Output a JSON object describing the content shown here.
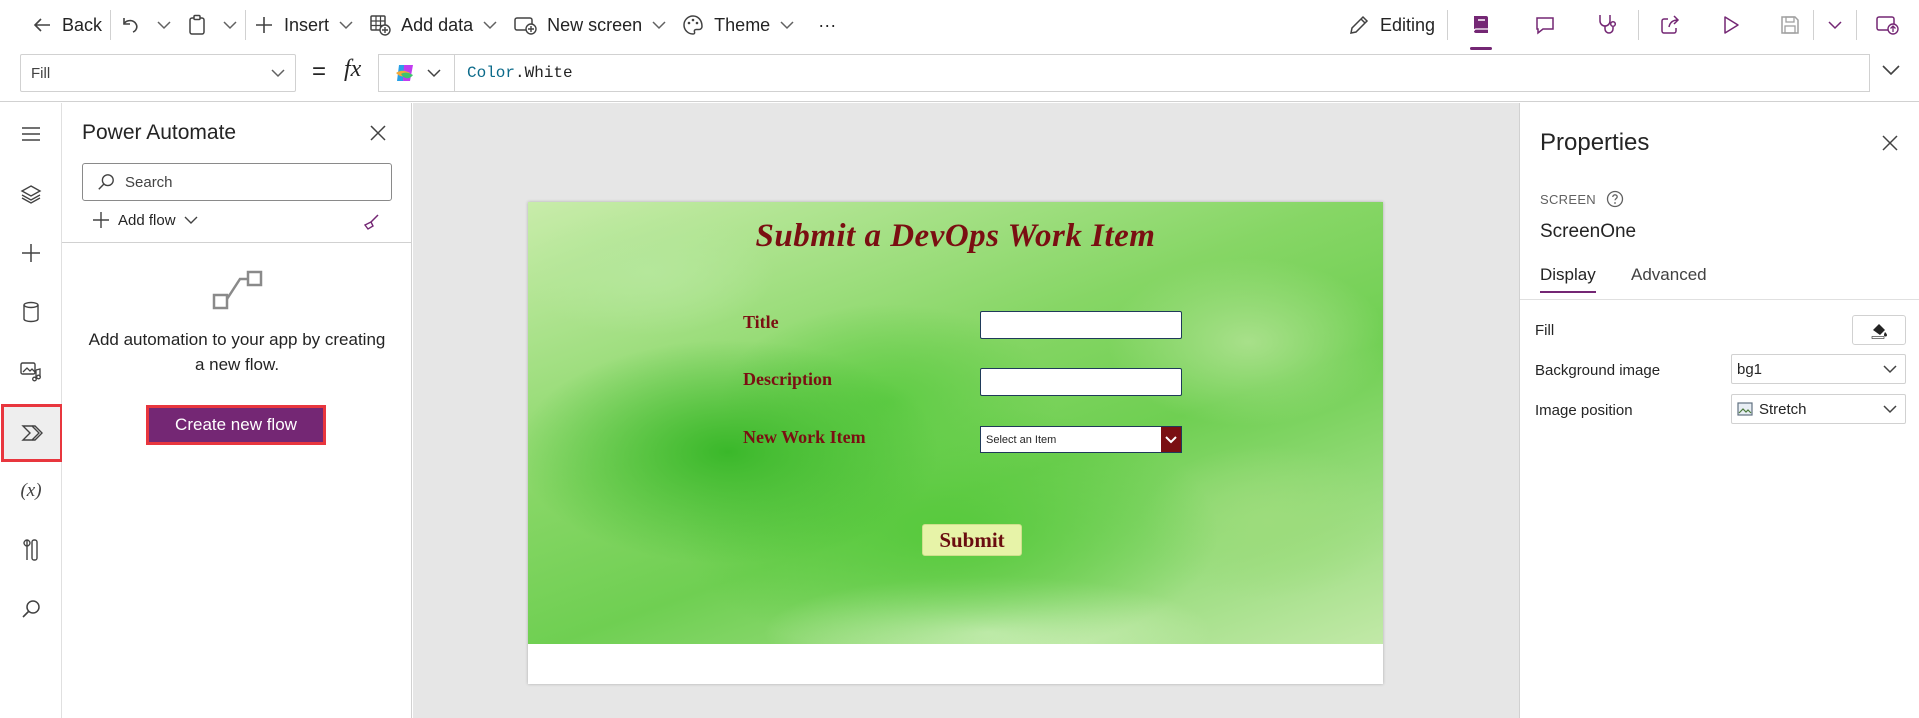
{
  "toolbar": {
    "back_label": "Back",
    "insert_label": "Insert",
    "add_data_label": "Add data",
    "new_screen_label": "New screen",
    "theme_label": "Theme",
    "more_label": "···",
    "editing_label": "Editing"
  },
  "formula": {
    "property": "Fill",
    "equals": "=",
    "fx": "fx",
    "value_keyword": "Color",
    "value_rest": ".White"
  },
  "power_automate": {
    "title": "Power Automate",
    "search_placeholder": "Search",
    "add_flow_label": "Add flow",
    "empty_message": "Add automation to your app by creating a new flow.",
    "create_button": "Create new flow"
  },
  "rail": {
    "variables_label": "(x)"
  },
  "app_screen": {
    "title": "Submit a DevOps Work Item",
    "fields": [
      {
        "label": "Title"
      },
      {
        "label": "Description"
      },
      {
        "label": "New Work Item"
      }
    ],
    "select_placeholder": "Select an Item",
    "submit_label": "Submit"
  },
  "properties": {
    "title": "Properties",
    "kind": "SCREEN",
    "screen_name": "ScreenOne",
    "tabs": [
      "Display",
      "Advanced"
    ],
    "active_tab": "Display",
    "rows": [
      {
        "label": "Fill"
      },
      {
        "label": "Background image",
        "value": "bg1"
      },
      {
        "label": "Image position",
        "value": "Stretch"
      }
    ]
  },
  "colors": {
    "brand": "#742774",
    "highlight": "#e8363e",
    "app_text": "#7a0f12"
  }
}
